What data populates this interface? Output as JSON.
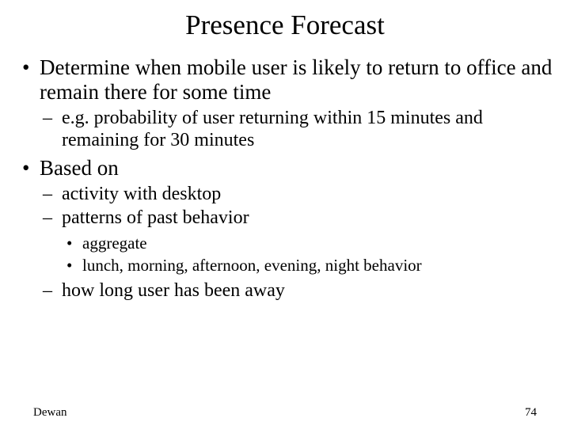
{
  "title": "Presence Forecast",
  "bullets": [
    {
      "text": "Determine when mobile user is likely to return to office and remain there for some time",
      "children": [
        {
          "text": "e.g. probability of user returning within 15 minutes and remaining for 30 minutes"
        }
      ]
    },
    {
      "text": "Based on",
      "children": [
        {
          "text": " activity with desktop"
        },
        {
          "text": "patterns of past behavior",
          "children": [
            {
              "text": "aggregate"
            },
            {
              "text": "lunch,  morning, afternoon, evening, night behavior"
            }
          ]
        },
        {
          "text": "how long user has been away"
        }
      ]
    }
  ],
  "footer": {
    "author": "Dewan",
    "page": "74"
  }
}
